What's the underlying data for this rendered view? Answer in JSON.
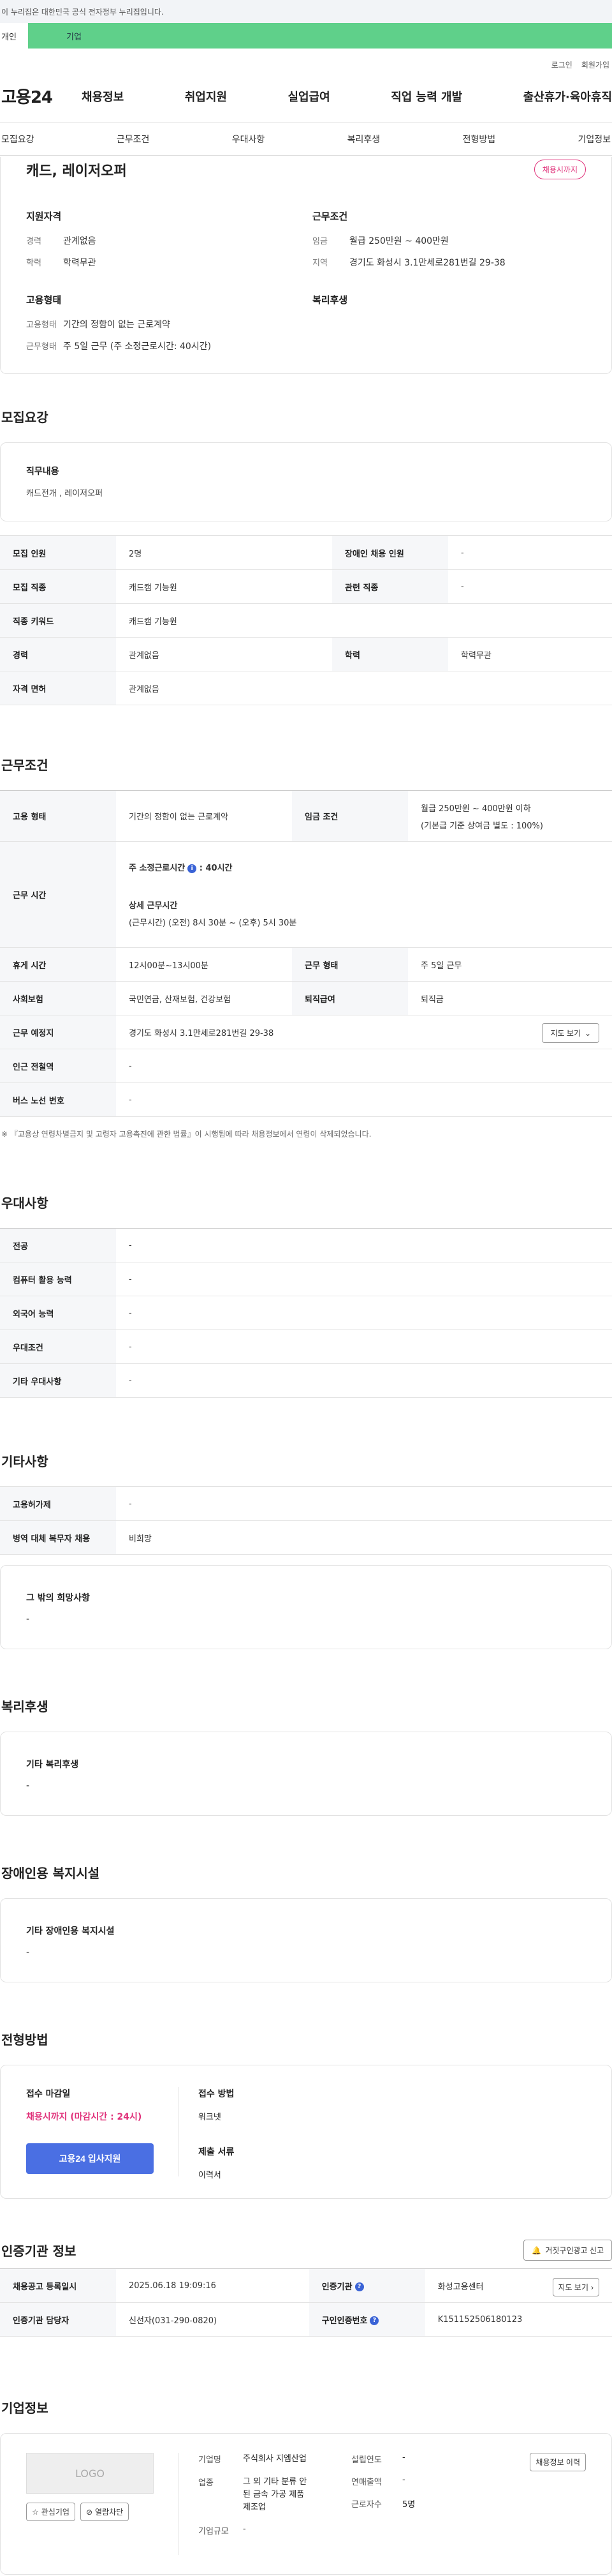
{
  "gov_notice": "이 누리집은 대한민국 공식 전자정부 누리집입니다.",
  "top_tabs": {
    "personal": "개인",
    "company": "기업"
  },
  "util": {
    "login": "로그인",
    "join": "회원가입"
  },
  "site_logo": "고용24",
  "gnb": [
    "채용정보",
    "취업지원",
    "실업급여",
    "직업 능력 개발",
    "출산휴가·육아휴직"
  ],
  "lnb": [
    "모집요강",
    "근무조건",
    "우대사항",
    "복리후생",
    "전형방법",
    "기업정보"
  ],
  "summary": {
    "title": "캐드, 레이저오퍼",
    "badge": "채용시까지",
    "qual_title": "지원자격",
    "qual": [
      {
        "k": "경력",
        "v": "관계없음"
      },
      {
        "k": "학력",
        "v": "학력무관"
      }
    ],
    "work_title": "근무조건",
    "work": [
      {
        "k": "임금",
        "v": "월급 250만원 ~ 400만원"
      },
      {
        "k": "지역",
        "v": "경기도 화성시 3.1만세로281번길 29-38"
      }
    ],
    "emp_title": "고용형태",
    "emp": [
      {
        "k": "고용형태",
        "v": "기간의 정함이 없는 근로계약"
      },
      {
        "k": "근무형태",
        "v": "주 5일 근무 (주 소정근로시간: 40시간)"
      }
    ],
    "welfare_title": "복리후생"
  },
  "recruit": {
    "title": "모집요강",
    "duty_label": "직무내용",
    "duty_value": "캐드전개 , 레이저오퍼",
    "rows": [
      [
        "모집 인원",
        "2명",
        "장애인 채용 인원",
        "-"
      ],
      [
        "모집 직종",
        "캐드캠 기능원",
        "관련 직종",
        "-"
      ],
      [
        "직종 키워드",
        "캐드캠 기능원"
      ],
      [
        "경력",
        "관계없음",
        "학력",
        "학력무관"
      ],
      [
        "자격 면허",
        "관계없음"
      ]
    ]
  },
  "work": {
    "title": "근무조건",
    "emp_type_label": "고용 형태",
    "emp_type": "기간의 정함이 없는 근로계약",
    "wage_label": "임금 조건",
    "wage_line1": "월급 250만원 ~ 400만원 이하",
    "wage_line2": "(기본급 기준 상여금 별도 : 100%)",
    "hours_label": "근무 시간",
    "hours_week": "주 소정근로시간",
    "hours_week_val": ": 40시간",
    "hours_detail_label": "상세 근무시간",
    "hours_detail": "(근무시간) (오전) 8시 30분 ~ (오후) 5시 30분",
    "break_label": "휴게 시간",
    "break_val": "12시00분~13시00분",
    "form_label": "근무 형태",
    "form_val": "주 5일 근무",
    "insurance_label": "사회보험",
    "insurance_val": "국민연금, 산재보험, 건강보험",
    "severance_label": "퇴직급여",
    "severance_val": "퇴직금",
    "place_label": "근무 예정지",
    "place_val": "경기도 화성시 3.1만세로281번길 29-38",
    "map_btn": "지도 보기",
    "subway_label": "인근 전철역",
    "subway_val": "-",
    "bus_label": "버스 노선 번호",
    "bus_val": "-",
    "note": "※ 『고용상 연령차별금지 및 고령자 고용촉진에 관한 법률』이 시행됨에 따라 채용정보에서 연령이 삭제되었습니다."
  },
  "prefer": {
    "title": "우대사항",
    "rows": [
      [
        "전공",
        "-"
      ],
      [
        "컴퓨터 활용 능력",
        "-"
      ],
      [
        "외국어 능력",
        "-"
      ],
      [
        "우대조건",
        "-"
      ],
      [
        "기타 우대사항",
        "-"
      ]
    ]
  },
  "etc": {
    "title": "기타사항",
    "rows": [
      [
        "고용허가제",
        "-"
      ],
      [
        "병역 대체 복무자 채용",
        "비희망"
      ]
    ],
    "other_label": "그 밖의 희망사항",
    "other_val": "-"
  },
  "welfare": {
    "title": "복리후생",
    "label": "기타 복리후생",
    "val": "-"
  },
  "disabled": {
    "title": "장애인용 복지시설",
    "label": "기타 장애인용 복지시설",
    "val": "-"
  },
  "selection": {
    "title": "전형방법",
    "deadline_label": "접수 마감일",
    "deadline_val": "채용시까지 (마감시간 : 24시)",
    "apply_btn": "고용24 입사지원",
    "method_label": "접수 방법",
    "method_val": "워크넷",
    "docs_label": "제출 서류",
    "docs_val": "이력서"
  },
  "cert": {
    "title": "인증기관 정보",
    "report_btn": "거짓구인광고 신고",
    "reg_date_label": "채용공고 등록일시",
    "reg_date": "2025.06.18 19:09:16",
    "agency_label": "인증기관",
    "agency": "화성고용센터",
    "map_btn": "지도 보기",
    "manager_label": "인증기관 담당자",
    "manager": "신선자(031-290-0820)",
    "number_label": "구인인증번호",
    "number": "K151152506180123"
  },
  "company": {
    "title": "기업정보",
    "logo_text": "LOGO",
    "fav_btn": "관심기업",
    "block_btn": "열람차단",
    "name_label": "기업명",
    "name": "주식회사 지엠산업",
    "industry_label": "업종",
    "industry": "그 외 기타 분류 안된 금속 가공 제품 제조업",
    "size_label": "기업규모",
    "size": "-",
    "founded_label": "설립연도",
    "founded": "-",
    "revenue_label": "연매출액",
    "revenue": "-",
    "employees_label": "근로자수",
    "employees": "5명",
    "history_btn": "채용정보 이력"
  }
}
